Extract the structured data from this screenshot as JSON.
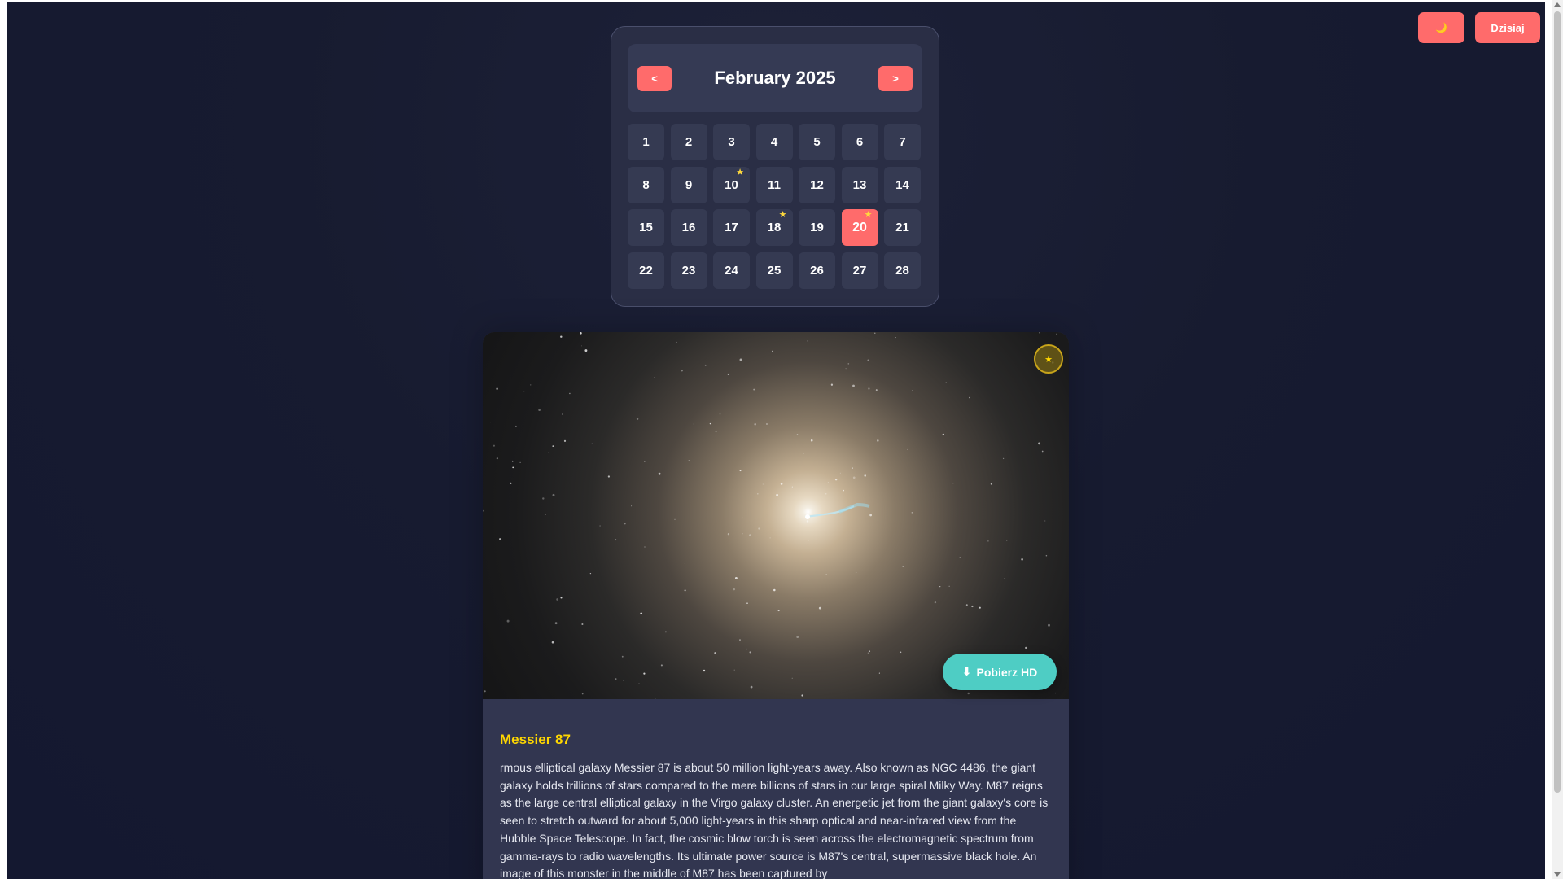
{
  "header": {
    "theme_toggle_icon": "moon-icon",
    "theme_toggle_glyph": "🌙",
    "today_label": "Dzisiaj"
  },
  "calendar": {
    "prev_label": "<",
    "next_label": ">",
    "month_title": "February 2025",
    "selected_day": 20,
    "days": [
      {
        "label": "1"
      },
      {
        "label": "2"
      },
      {
        "label": "3"
      },
      {
        "label": "4"
      },
      {
        "label": "5"
      },
      {
        "label": "6"
      },
      {
        "label": "7"
      },
      {
        "label": "8"
      },
      {
        "label": "9"
      },
      {
        "label": "10",
        "favorite": true
      },
      {
        "label": "11"
      },
      {
        "label": "12"
      },
      {
        "label": "13"
      },
      {
        "label": "14"
      },
      {
        "label": "15"
      },
      {
        "label": "16"
      },
      {
        "label": "17"
      },
      {
        "label": "18",
        "favorite": true
      },
      {
        "label": "19"
      },
      {
        "label": "20",
        "favorite": true,
        "selected": true
      },
      {
        "label": "21"
      },
      {
        "label": "22"
      },
      {
        "label": "23"
      },
      {
        "label": "24"
      },
      {
        "label": "25"
      },
      {
        "label": "26"
      },
      {
        "label": "27"
      },
      {
        "label": "28"
      }
    ]
  },
  "apod": {
    "favorite_glyph": "★",
    "download_glyph": "⬇",
    "download_label": "Pobierz HD",
    "title": "Messier 87",
    "explanation": "rmous elliptical galaxy Messier 87 is about 50 million light-years away. Also known as NGC 4486, the giant galaxy holds trillions of stars compared to the mere billions of stars in our large spiral Milky Way. M87 reigns as the large central elliptical galaxy in the Virgo galaxy cluster. An energetic jet from the giant galaxy's core is seen to stretch outward for about 5,000 light-years in this sharp optical and near-infrared view from the Hubble Space Telescope. In fact, the cosmic blow torch is seen across the electromagnetic spectrum from gamma-rays to radio wavelengths. Its ultimate power source is M87's central, supermassive black hole. An image of this monster in the middle of M87 has been captured by"
  },
  "colors": {
    "accent": "#ff6b6b",
    "teal": "#4ecdc4",
    "gold": "#ffd700",
    "star": "#ffd93d"
  }
}
